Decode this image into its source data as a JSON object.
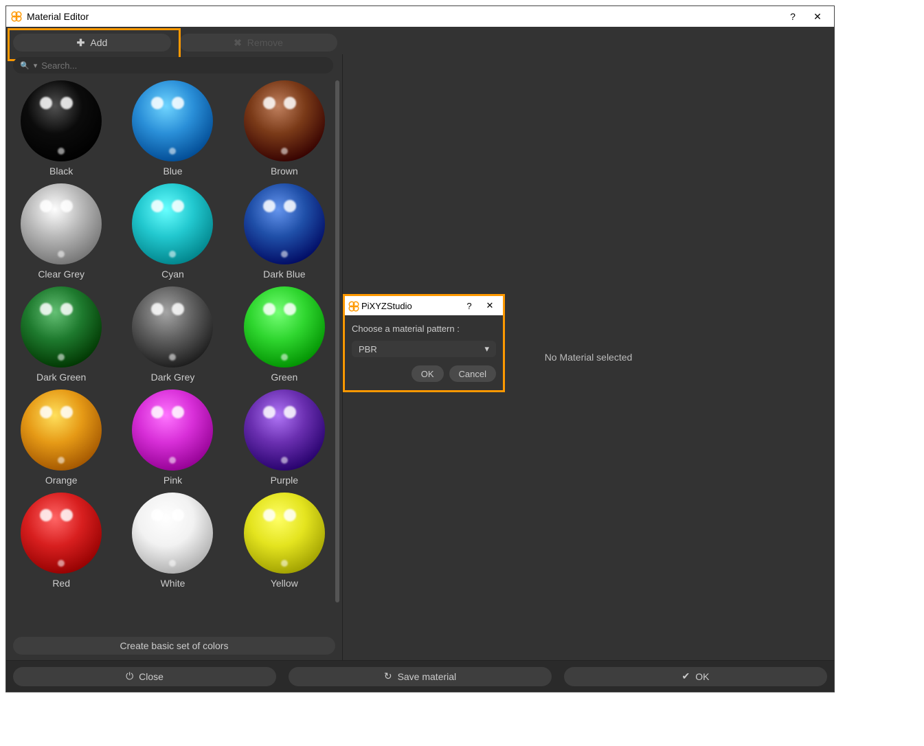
{
  "window": {
    "title": "Material Editor",
    "help_glyph": "?",
    "close_glyph": "✕"
  },
  "toolbar": {
    "add_label": "Add",
    "remove_label": "Remove"
  },
  "search": {
    "placeholder": "Search..."
  },
  "materials": [
    {
      "name": "Black",
      "color": "#0b0b0b"
    },
    {
      "name": "Blue",
      "color": "#2a8fd8"
    },
    {
      "name": "Brown",
      "color": "#7a3a18"
    },
    {
      "name": "Clear Grey",
      "color": "#b8b8b8"
    },
    {
      "name": "Cyan",
      "color": "#22c8cf"
    },
    {
      "name": "Dark Blue",
      "color": "#1f4fa8"
    },
    {
      "name": "Dark Green",
      "color": "#1e7a2e"
    },
    {
      "name": "Dark Grey",
      "color": "#5f5f5f"
    },
    {
      "name": "Green",
      "color": "#2fd62f"
    },
    {
      "name": "Orange",
      "color": "#e69a16"
    },
    {
      "name": "Pink",
      "color": "#d82fd8"
    },
    {
      "name": "Purple",
      "color": "#6a2fb0"
    },
    {
      "name": "Red",
      "color": "#d81f1f"
    },
    {
      "name": "White",
      "color": "#f2f2f2"
    },
    {
      "name": "Yellow",
      "color": "#e4e41f"
    }
  ],
  "left_pane": {
    "create_basic_label": "Create basic set of colors"
  },
  "right_pane": {
    "empty_text": "No Material selected"
  },
  "footer": {
    "close_label": "Close",
    "save_label": "Save material",
    "ok_label": "OK"
  },
  "dialog": {
    "title": "PiXYZStudio",
    "help_glyph": "?",
    "close_glyph": "✕",
    "prompt": "Choose a material pattern :",
    "selected": "PBR",
    "ok_label": "OK",
    "cancel_label": "Cancel"
  },
  "icons": {
    "plus": "✚",
    "remove": "✖",
    "search": "🔍",
    "dropdown": "▾",
    "power": "⏻",
    "refresh": "↻",
    "check": "✔"
  },
  "colors": {
    "highlight": "#ff9900",
    "panel": "#333333",
    "button": "#3e3e3e"
  }
}
